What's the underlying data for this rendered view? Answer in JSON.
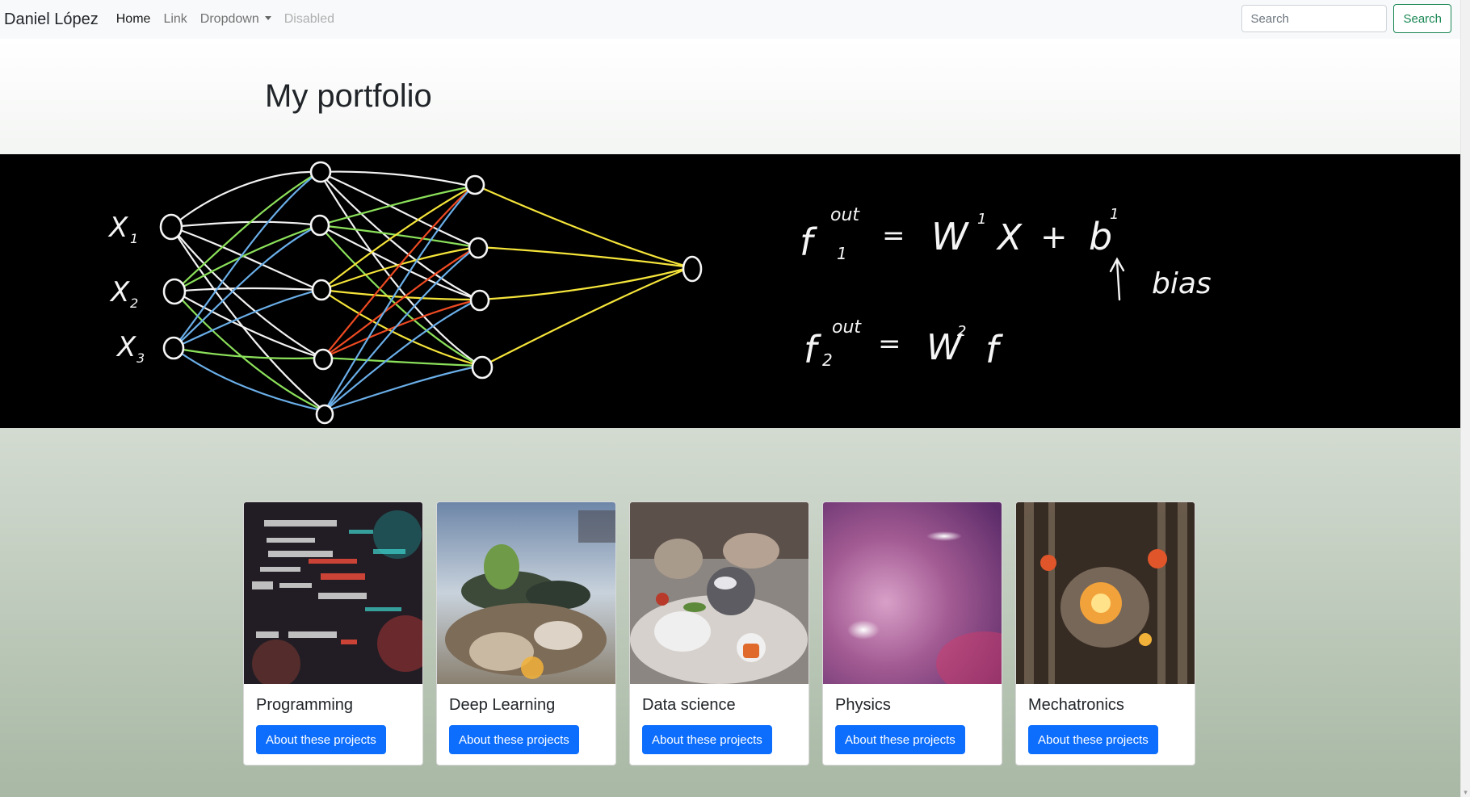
{
  "navbar": {
    "brand": "Daniel López",
    "links": [
      {
        "label": "Home"
      },
      {
        "label": "Link"
      },
      {
        "label": "Dropdown"
      },
      {
        "label": "Disabled"
      }
    ],
    "search": {
      "placeholder": "Search",
      "value": "",
      "button_label": "Search"
    }
  },
  "header": {
    "title": "My portfolio"
  },
  "banner": {
    "inputs": [
      "X",
      "X",
      "X"
    ],
    "input_subscripts": [
      "1",
      "2",
      "3"
    ],
    "equations": {
      "eq1": {
        "lhs": "f",
        "sup": "out",
        "sub": "1",
        "rhs_w": "W",
        "rhs_w_sup": "1",
        "rhs_x": "X",
        "plus": "+",
        "rhs_b": "b",
        "rhs_b_sup": "1",
        "eq": "="
      },
      "eq2": {
        "lhs": "f",
        "sup": "out",
        "sub": "2",
        "rhs_w": "W",
        "rhs_w_sup": "2",
        "rhs_f": "f",
        "eq": "="
      },
      "bias_label": "bias"
    }
  },
  "cards": [
    {
      "title": "Programming",
      "button": "About these projects"
    },
    {
      "title": "Deep Learning",
      "button": "About these projects"
    },
    {
      "title": "Data science",
      "button": "About these projects"
    },
    {
      "title": "Physics",
      "button": "About these projects"
    },
    {
      "title": "Mechatronics",
      "button": "About these projects"
    }
  ],
  "colors": {
    "primary": "#0d6efd",
    "success": "#198754",
    "navbar_bg": "#f8f9fa"
  }
}
